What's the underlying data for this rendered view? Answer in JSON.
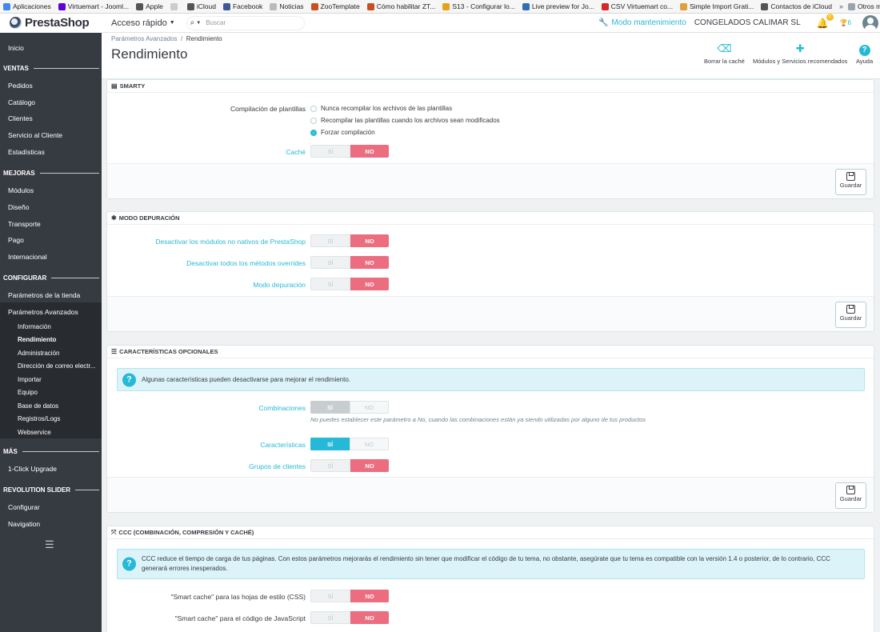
{
  "bookmarks": {
    "items": [
      {
        "label": "Aplicaciones",
        "icon": "apps-grid-icon",
        "color": "#4285f4"
      },
      {
        "label": "Virtuemart - Jooml...",
        "icon": "yahoo-icon",
        "color": "#5f01d1"
      },
      {
        "label": "Apple",
        "icon": "apple-icon",
        "color": "#555555"
      },
      {
        "label": "",
        "icon": "page-icon",
        "color": "#cccccc"
      },
      {
        "label": "iCloud",
        "icon": "apple-icon",
        "color": "#555555"
      },
      {
        "label": "Facebook",
        "icon": "facebook-icon",
        "color": "#3b5998"
      },
      {
        "label": "Noticias",
        "icon": "page-icon",
        "color": "#bbbbbb"
      },
      {
        "label": "ZooTemplate",
        "icon": "zoo-icon",
        "color": "#c94f1f"
      },
      {
        "label": "Cómo habilitar ZT...",
        "icon": "zoo-icon",
        "color": "#c94f1f"
      },
      {
        "label": "S13 - Configurar lo...",
        "icon": "globe-icon",
        "color": "#e4a11b"
      },
      {
        "label": "Live preview for Jo...",
        "icon": "preview-icon",
        "color": "#2f6db5"
      },
      {
        "label": "CSV Virtuemart co...",
        "icon": "sj-icon",
        "color": "#d62828"
      },
      {
        "label": "Simple Import Grati...",
        "icon": "import-icon",
        "color": "#e0a03a"
      },
      {
        "label": "Contactos de iCloud",
        "icon": "apple-icon",
        "color": "#555555"
      }
    ],
    "more": "»",
    "other": "Otros marcadores"
  },
  "header": {
    "logo": "PrestaShop",
    "quick_access": "Acceso rápido",
    "search_placeholder": "Buscar",
    "maintenance": "Modo mantenimiento",
    "shop_name": "CONGELADOS CALIMAR SL",
    "notifications_count": "0",
    "trophy_count": "6"
  },
  "sidebar": {
    "home": "Inicio",
    "sections": [
      {
        "title": "VENTAS",
        "items": [
          "Pedidos",
          "Catálogo",
          "Clientes",
          "Servicio al Cliente",
          "Estadísticas"
        ]
      },
      {
        "title": "MEJORAS",
        "items": [
          "Módulos",
          "Diseño",
          "Transporte",
          "Pago",
          "Internacional"
        ]
      },
      {
        "title": "CONFIGURAR",
        "items": [
          "Parámetros de la tienda",
          "Parámetros Avanzados"
        ]
      },
      {
        "title": "MÁS",
        "items": [
          "1-Click Upgrade"
        ]
      },
      {
        "title": "REVOLUTION SLIDER",
        "items": [
          "Configurar",
          "Navigation"
        ]
      }
    ],
    "submenu": [
      "Información",
      "Rendimiento",
      "Administración",
      "Dirección de correo electr...",
      "Importar",
      "Equipo",
      "Base de datos",
      "Registros/Logs",
      "Webservice"
    ],
    "active_sub": "Rendimiento"
  },
  "toolbar": {
    "breadcrumb": [
      "Parámetros Avanzados",
      "Rendimiento"
    ],
    "breadcrumb_sep": "/",
    "title": "Rendimiento",
    "buttons": [
      {
        "label": "Borrar la caché",
        "icon": "eraser-icon"
      },
      {
        "label": "Módulos y Servicios recomendados",
        "icon": "puzzle-icon"
      },
      {
        "label": "Ayuda",
        "icon": "help-icon"
      }
    ]
  },
  "switch": {
    "yes": "SÍ",
    "no": "NO"
  },
  "save_label": "Guardar",
  "smarty": {
    "title": "SMARTY",
    "template_label": "Compilación de plantillas",
    "options": [
      {
        "label": "Nunca recompilar los archivos de las plantillas",
        "selected": false
      },
      {
        "label": "Recompilar las plantillas cuando los archivos sean modificados",
        "selected": false
      },
      {
        "label": "Forzar compilación",
        "selected": true
      }
    ],
    "cache_label": "Caché",
    "cache_value": "NO"
  },
  "debug": {
    "title": "MODO DEPURACIÓN",
    "rows": [
      {
        "label": "Desactivar los módulos no nativos de PrestaShop",
        "value": "NO"
      },
      {
        "label": "Desactivar todos los métodos overrides",
        "value": "NO"
      },
      {
        "label": "Modo depuración",
        "value": "NO"
      }
    ]
  },
  "optional": {
    "title": "CARACTERÍSTICAS OPCIONALES",
    "alert": "Algunas características pueden desactivarse para mejorar el rendimiento.",
    "rows": [
      {
        "label": "Combinaciones",
        "value": "SÍ",
        "disabled": true,
        "help": "No puedes establecer este parámetro a No, cuando las combinaciones están ya siendo utilizadas por alguno de tus productos"
      },
      {
        "label": "Características",
        "value": "SÍ",
        "disabled": false,
        "help": ""
      },
      {
        "label": "Grupos de clientes",
        "value": "NO",
        "disabled": false,
        "help": ""
      }
    ]
  },
  "ccc": {
    "title": "CCC (COMBINACIÓN, COMPRESIÓN Y CACHÉ)",
    "alert": "CCC reduce el tiempo de carga de tus páginas. Con estos parámetros mejorarás el rendimiento sin tener que modificar el código de tu tema, no obstante, asegúrate que tu tema es compatible con la versión 1.4 o posterior, de lo contrario, CCC generará errores inesperados.",
    "rows": [
      {
        "label": "\"Smart cache\" para las hojas de estilo (CSS)",
        "value": "NO"
      },
      {
        "label": "\"Smart cache\" para el código de JavaScript",
        "value": "NO"
      }
    ]
  },
  "colors": {
    "accent": "#25b9d7",
    "no": "#ed6d80",
    "sidebar": "#363a41"
  }
}
